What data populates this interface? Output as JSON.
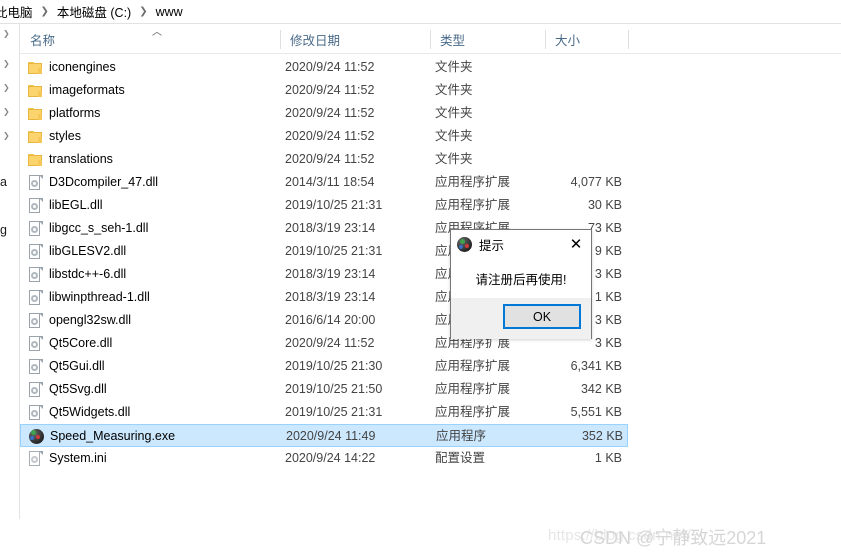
{
  "window": {
    "type": "file-explorer"
  },
  "addressbar": {
    "crumbs": [
      "此电脑",
      "本地磁盘 (C:)",
      "www"
    ],
    "separator": "❯"
  },
  "navpane": {
    "fragments": [
      {
        "chevron": "❯",
        "text": ""
      },
      {
        "chevron": "❯",
        "text": ""
      },
      {
        "chevron": "❯",
        "text": ""
      },
      {
        "chevron": "❯",
        "text": ""
      },
      {
        "chevron": "❯",
        "text": ""
      },
      {
        "chevron": "",
        "text": "a"
      },
      {
        "chevron": "",
        "text": ""
      },
      {
        "chevron": "",
        "text": "g"
      }
    ]
  },
  "columns": {
    "name": "名称",
    "date_modified": "修改日期",
    "type": "类型",
    "size": "大小",
    "sort_indicator": "︿"
  },
  "files": [
    {
      "icon": "folder-icon",
      "name": "iconengines",
      "date": "2020/9/24 11:52",
      "type": "文件夹",
      "size": ""
    },
    {
      "icon": "folder-icon",
      "name": "imageformats",
      "date": "2020/9/24 11:52",
      "type": "文件夹",
      "size": ""
    },
    {
      "icon": "folder-icon",
      "name": "platforms",
      "date": "2020/9/24 11:52",
      "type": "文件夹",
      "size": ""
    },
    {
      "icon": "folder-icon",
      "name": "styles",
      "date": "2020/9/24 11:52",
      "type": "文件夹",
      "size": ""
    },
    {
      "icon": "folder-icon",
      "name": "translations",
      "date": "2020/9/24 11:52",
      "type": "文件夹",
      "size": ""
    },
    {
      "icon": "dll-file-icon",
      "name": "D3Dcompiler_47.dll",
      "date": "2014/3/11 18:54",
      "type": "应用程序扩展",
      "size": "4,077 KB"
    },
    {
      "icon": "dll-file-icon",
      "name": "libEGL.dll",
      "date": "2019/10/25 21:31",
      "type": "应用程序扩展",
      "size": "30 KB"
    },
    {
      "icon": "dll-file-icon",
      "name": "libgcc_s_seh-1.dll",
      "date": "2018/3/19 23:14",
      "type": "应用程序扩展",
      "size": "73 KB"
    },
    {
      "icon": "dll-file-icon",
      "name": "libGLESV2.dll",
      "date": "2019/10/25 21:31",
      "type": "应用程序扩展",
      "size": "9 KB"
    },
    {
      "icon": "dll-file-icon",
      "name": "libstdc++-6.dll",
      "date": "2018/3/19 23:14",
      "type": "应用程序扩展",
      "size": "3 KB"
    },
    {
      "icon": "dll-file-icon",
      "name": "libwinpthread-1.dll",
      "date": "2018/3/19 23:14",
      "type": "应用程序扩展",
      "size": "1 KB"
    },
    {
      "icon": "dll-file-icon",
      "name": "opengl32sw.dll",
      "date": "2016/6/14 20:00",
      "type": "应用程序扩展",
      "size": "3 KB"
    },
    {
      "icon": "dll-file-icon",
      "name": "Qt5Core.dll",
      "date": "2020/9/24 11:52",
      "type": "应用程序扩展",
      "size": "3 KB"
    },
    {
      "icon": "dll-file-icon",
      "name": "Qt5Gui.dll",
      "date": "2019/10/25 21:30",
      "type": "应用程序扩展",
      "size": "6,341 KB"
    },
    {
      "icon": "dll-file-icon",
      "name": "Qt5Svg.dll",
      "date": "2019/10/25 21:50",
      "type": "应用程序扩展",
      "size": "342 KB"
    },
    {
      "icon": "dll-file-icon",
      "name": "Qt5Widgets.dll",
      "date": "2019/10/25 21:31",
      "type": "应用程序扩展",
      "size": "5,551 KB"
    },
    {
      "icon": "app-exe-icon",
      "name": "Speed_Measuring.exe",
      "date": "2020/9/24 11:49",
      "type": "应用程序",
      "size": "352 KB",
      "selected": true
    },
    {
      "icon": "ini-file-icon",
      "name": "System.ini",
      "date": "2020/9/24 14:22",
      "type": "配置设置",
      "size": "1 KB"
    }
  ],
  "dialog": {
    "title": "提示",
    "close_label": "✕",
    "message": "请注册后再使用!",
    "ok_label": "OK",
    "accent_color": "#0078d7"
  },
  "watermark": {
    "url": "https://blog.csdn.net/...",
    "brand": "CSDN @宁静致远2021"
  }
}
